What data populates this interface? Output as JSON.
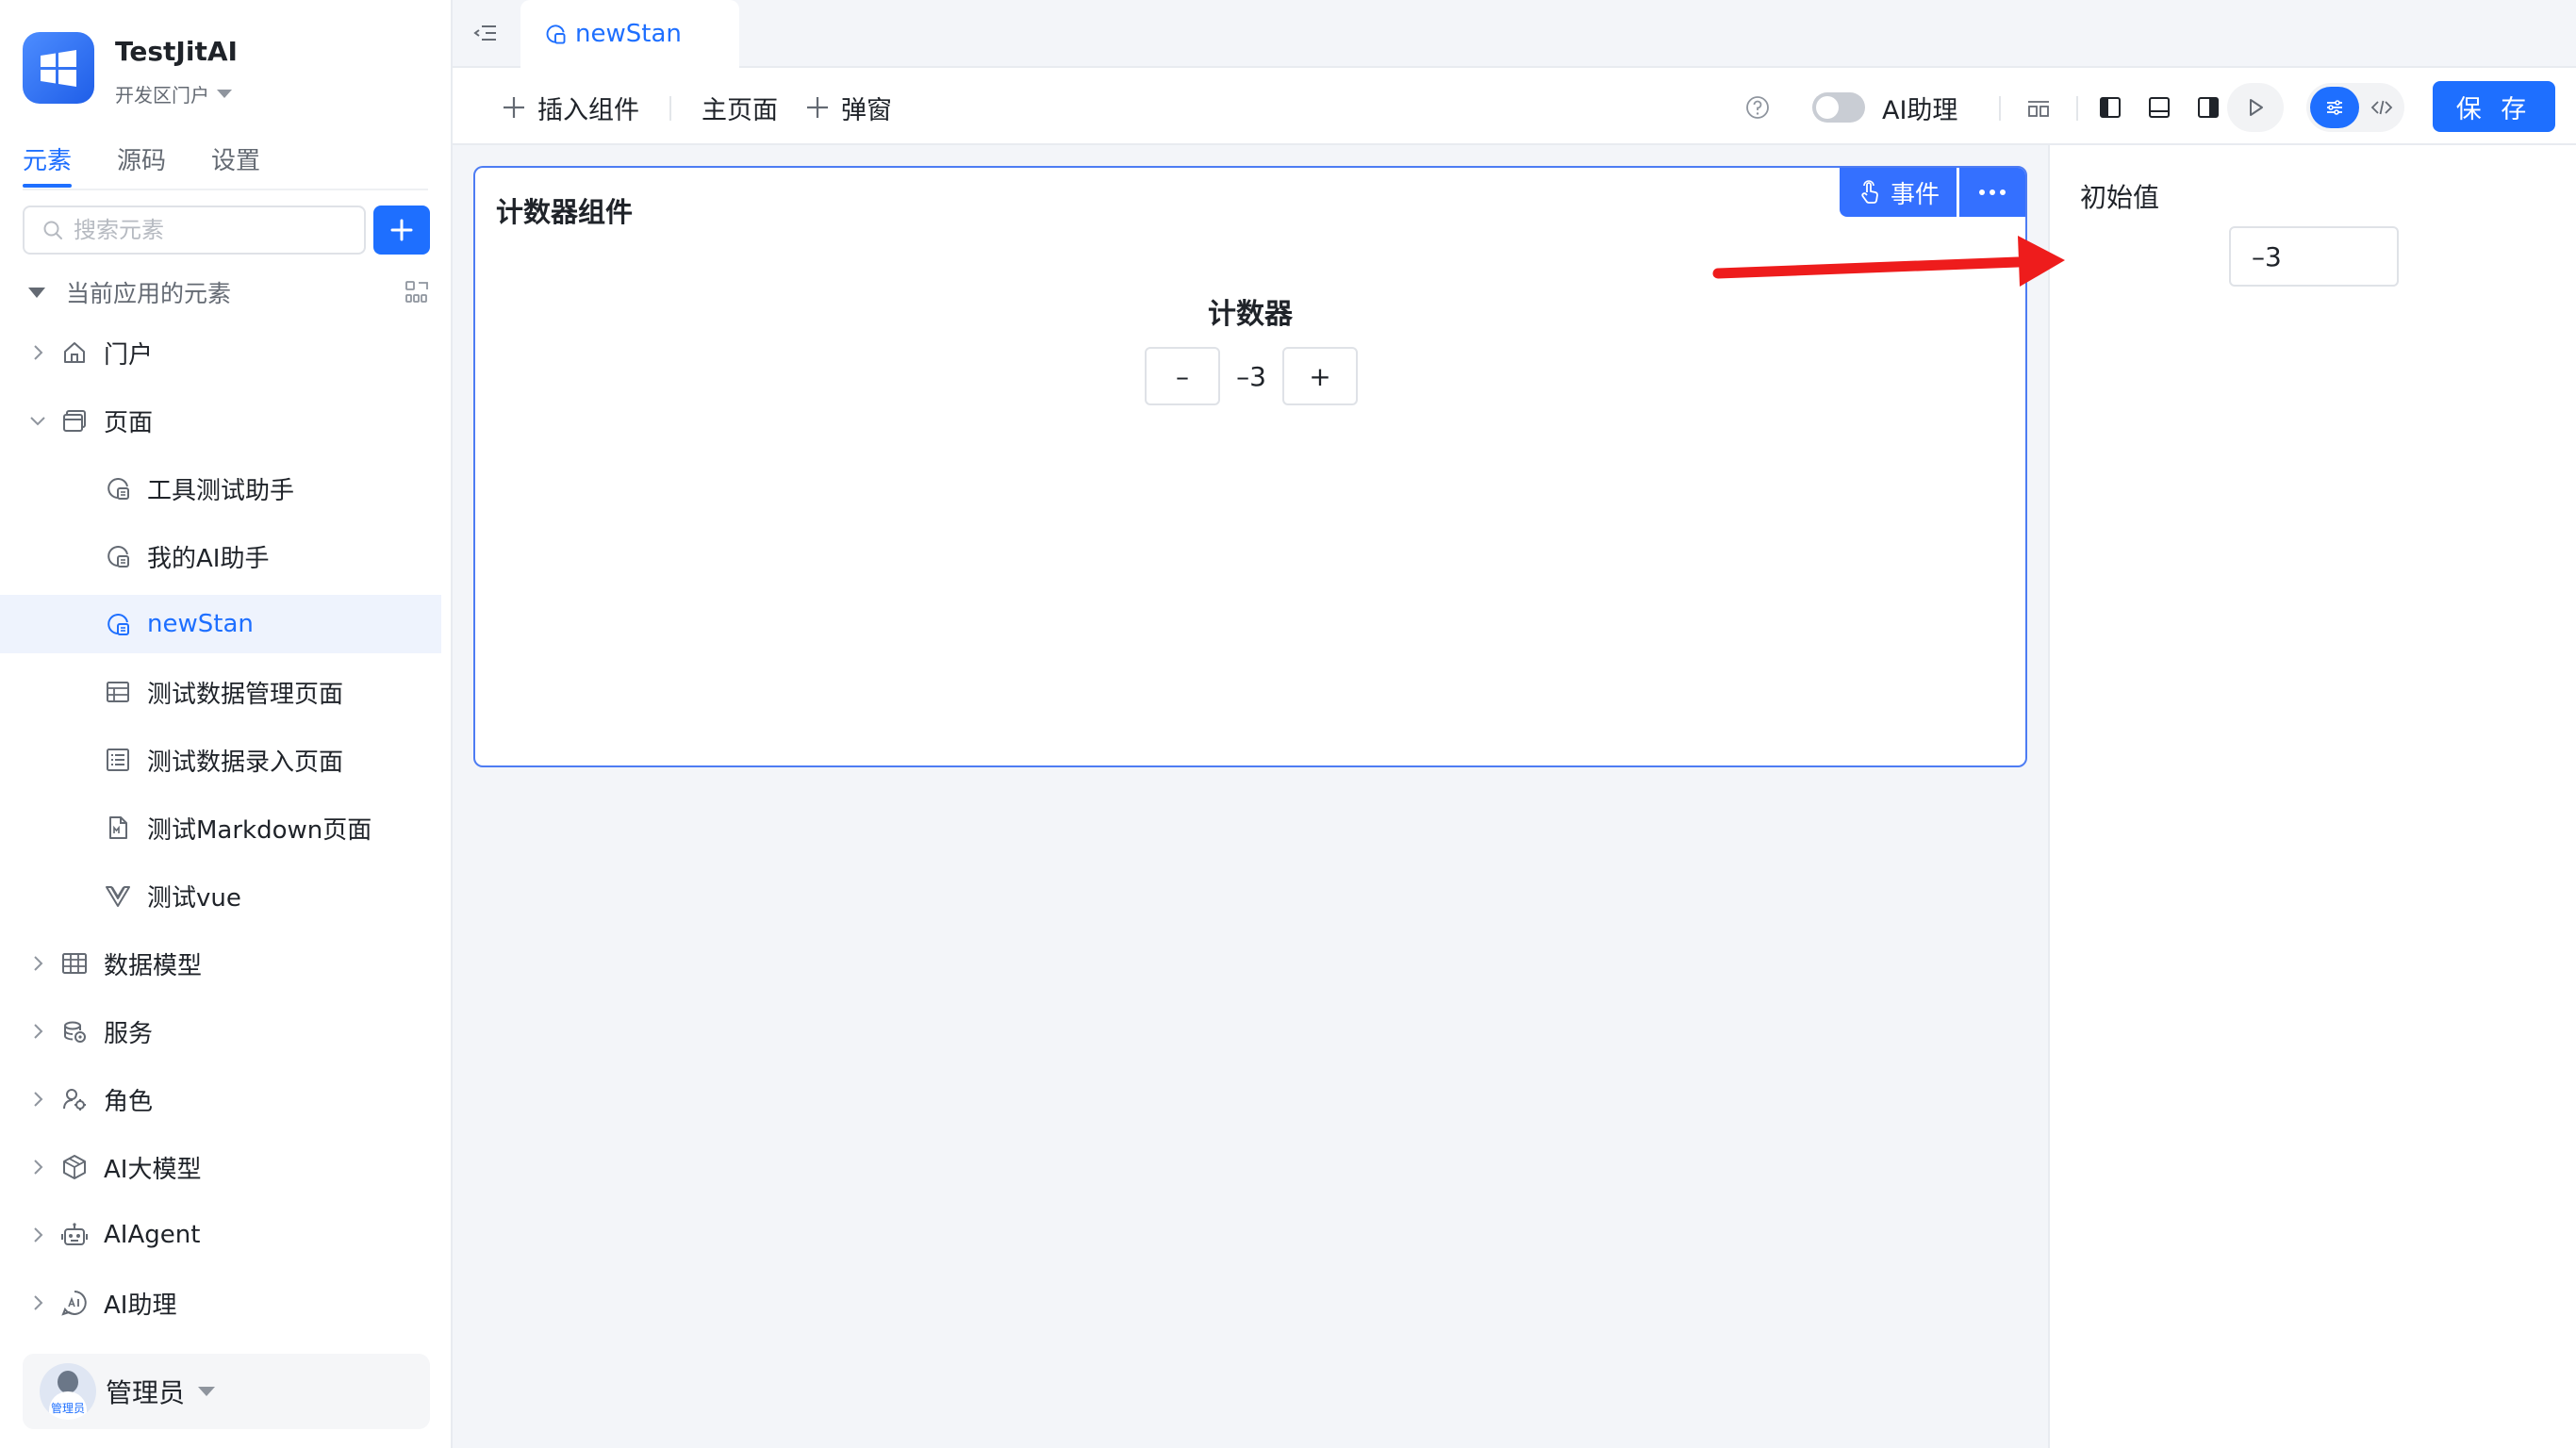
{
  "app": {
    "name": "TestJitAI",
    "portal": "开发区门户"
  },
  "sidebar": {
    "tabs": [
      {
        "label": "元素",
        "active": true
      },
      {
        "label": "源码",
        "active": false
      },
      {
        "label": "设置",
        "active": false
      }
    ],
    "search_placeholder": "搜索元素",
    "tree_header": "当前应用的元素",
    "items": [
      {
        "label": "门户",
        "icon": "home-icon",
        "expanded": false
      },
      {
        "label": "页面",
        "icon": "page-icon",
        "expanded": true
      },
      {
        "label": "工具测试助手",
        "icon": "ai-page-icon"
      },
      {
        "label": "我的AI助手",
        "icon": "ai-page-icon"
      },
      {
        "label": "newStan",
        "icon": "ai-page-icon",
        "selected": true
      },
      {
        "label": "测试数据管理页面",
        "icon": "table-page-icon"
      },
      {
        "label": "测试数据录入页面",
        "icon": "form-page-icon"
      },
      {
        "label": "测试Markdown页面",
        "icon": "markdown-file-icon"
      },
      {
        "label": "测试vue",
        "icon": "vue-icon"
      },
      {
        "label": "数据模型",
        "icon": "data-model-icon",
        "expanded": false
      },
      {
        "label": "服务",
        "icon": "service-icon",
        "expanded": false
      },
      {
        "label": "角色",
        "icon": "role-icon",
        "expanded": false
      },
      {
        "label": "AI大模型",
        "icon": "ai-model-icon",
        "expanded": false
      },
      {
        "label": "AIAgent",
        "icon": "robot-icon",
        "expanded": false
      },
      {
        "label": "AI助理",
        "icon": "ai-assistant-icon",
        "expanded": false
      }
    ],
    "user": {
      "name": "管理员",
      "avatar_text": "管理员"
    }
  },
  "tabs": {
    "open_tab": "newStan"
  },
  "toolbar": {
    "insert_component": "插入组件",
    "main_page": "主页面",
    "popup": "弹窗",
    "ai_assistant_label": "AI助理",
    "ai_assistant_enabled": false,
    "save": "保 存"
  },
  "canvas": {
    "component_title": "计数器组件",
    "event_button": "事件",
    "counter": {
      "title": "计数器",
      "minus": "–",
      "value": "–3",
      "plus": "+"
    }
  },
  "properties": {
    "initial_value_label": "初始值",
    "initial_value": "–3"
  },
  "colors": {
    "primary": "#1e6fff",
    "selection_bg": "#eef3fd",
    "component_border": "#4d7cf3",
    "annotation_arrow": "#ee1c1c"
  }
}
